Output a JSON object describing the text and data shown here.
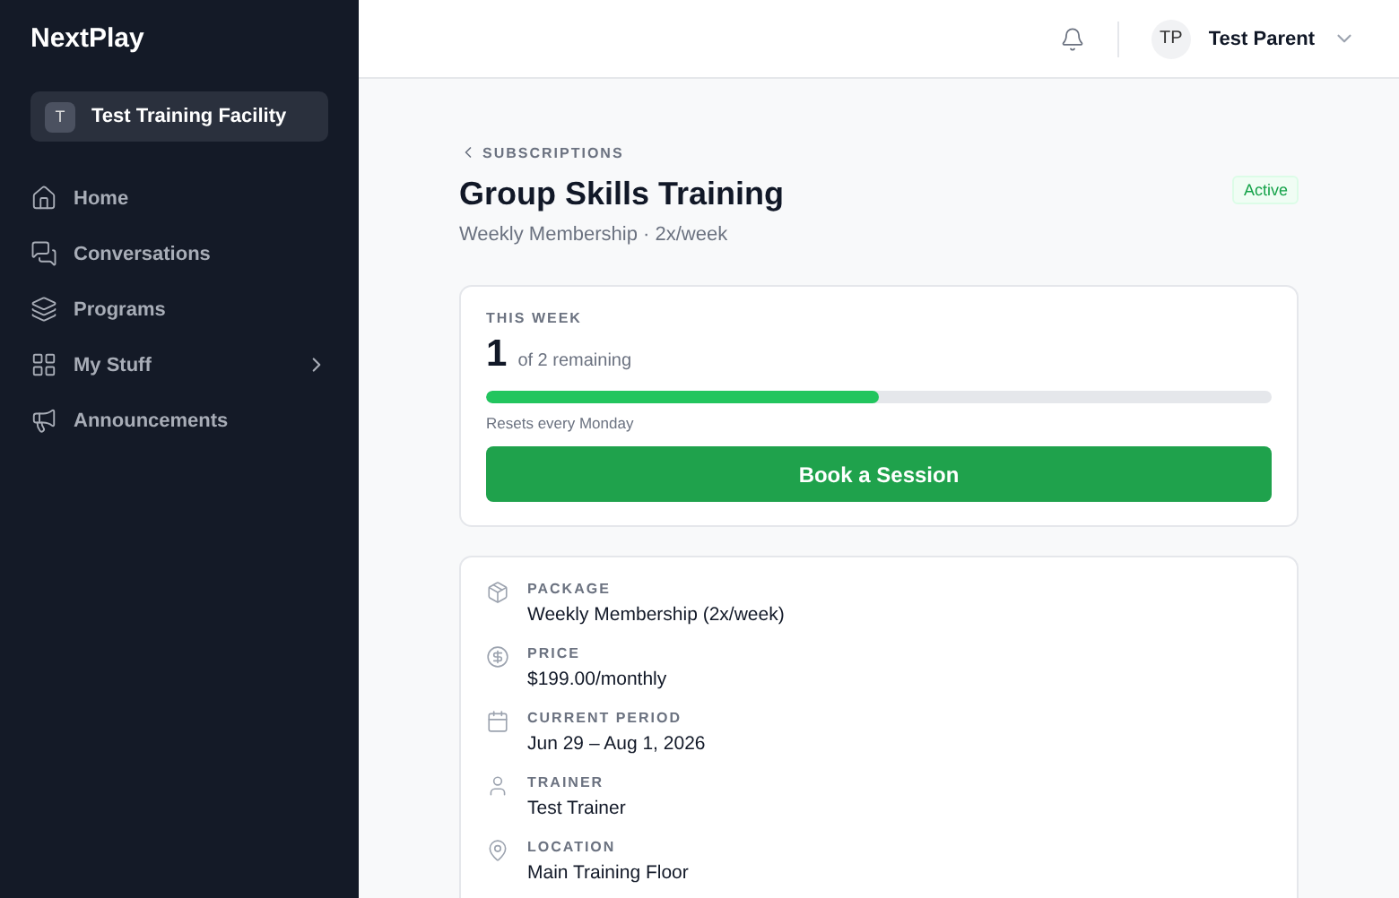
{
  "sidebar": {
    "logo": "NextPlay",
    "facility": {
      "initial": "T",
      "name": "Test Training Facility"
    },
    "items": [
      {
        "label": "Home",
        "has_submenu": false
      },
      {
        "label": "Conversations",
        "has_submenu": false
      },
      {
        "label": "Programs",
        "has_submenu": false
      },
      {
        "label": "My Stuff",
        "has_submenu": true
      },
      {
        "label": "Announcements",
        "has_submenu": false
      }
    ]
  },
  "header": {
    "user": {
      "initials": "TP",
      "name": "Test Parent"
    }
  },
  "breadcrumb": "SUBSCRIPTIONS",
  "title": "Group Skills Training",
  "subtitle": "Weekly Membership · 2x/week",
  "status": "Active",
  "this_week": {
    "label": "THIS WEEK",
    "count": "1",
    "remaining": "of 2 remaining",
    "level": 0.5,
    "note": "Resets every Monday",
    "button": "Book a Session"
  },
  "details": [
    {
      "label": "PACKAGE",
      "value": "Weekly Membership (2x/week)"
    },
    {
      "label": "PRICE",
      "value": "$199.00/monthly"
    },
    {
      "label": "CURRENT PERIOD",
      "value": "Jun 29 – Aug 1, 2026"
    },
    {
      "label": "TRAINER",
      "value": "Test Trainer"
    },
    {
      "label": "LOCATION",
      "value": "Main Training Floor"
    }
  ]
}
